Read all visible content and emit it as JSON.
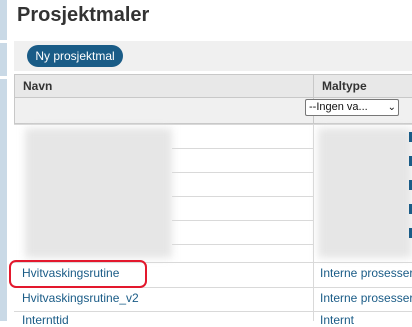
{
  "page": {
    "title": "Prosjektmaler"
  },
  "toolbar": {
    "new_button_label": "Ny prosjektmal"
  },
  "table": {
    "columns": [
      "Navn",
      "Maltype"
    ],
    "filter": {
      "type_value": "--Ingen va...",
      "type_chevron": "⌄"
    },
    "rows": [
      {
        "name": "Hvitvaskingsrutine",
        "type": "Interne prosesser"
      },
      {
        "name": "Hvitvaskingsrutine_v2",
        "type": "Interne prosesser"
      },
      {
        "name": "Internttid",
        "type": "Internt"
      }
    ]
  },
  "colors": {
    "accent": "#1a5c87",
    "highlight": "#e3182d"
  }
}
